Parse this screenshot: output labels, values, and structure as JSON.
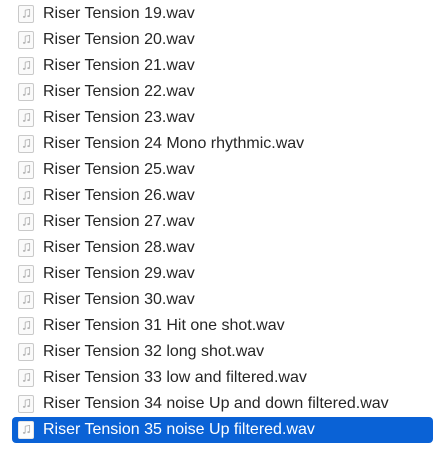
{
  "colors": {
    "selection": "#0a62d6",
    "text": "#262626",
    "selected_text": "#ffffff"
  },
  "file_icon": "audio-file-icon",
  "files": [
    {
      "name": "Riser Tension 19.wav",
      "selected": false
    },
    {
      "name": "Riser Tension 20.wav",
      "selected": false
    },
    {
      "name": "Riser Tension 21.wav",
      "selected": false
    },
    {
      "name": "Riser Tension 22.wav",
      "selected": false
    },
    {
      "name": "Riser Tension 23.wav",
      "selected": false
    },
    {
      "name": "Riser Tension 24 Mono rhythmic.wav",
      "selected": false
    },
    {
      "name": "Riser Tension 25.wav",
      "selected": false
    },
    {
      "name": "Riser Tension 26.wav",
      "selected": false
    },
    {
      "name": "Riser Tension 27.wav",
      "selected": false
    },
    {
      "name": "Riser Tension 28.wav",
      "selected": false
    },
    {
      "name": "Riser Tension 29.wav",
      "selected": false
    },
    {
      "name": "Riser Tension 30.wav",
      "selected": false
    },
    {
      "name": "Riser Tension 31 Hit one shot.wav",
      "selected": false
    },
    {
      "name": "Riser Tension 32 long shot.wav",
      "selected": false
    },
    {
      "name": "Riser Tension 33 low and filtered.wav",
      "selected": false
    },
    {
      "name": "Riser Tension 34 noise Up and down filtered.wav",
      "selected": false
    },
    {
      "name": "Riser Tension 35 noise Up filtered.wav",
      "selected": true
    }
  ]
}
